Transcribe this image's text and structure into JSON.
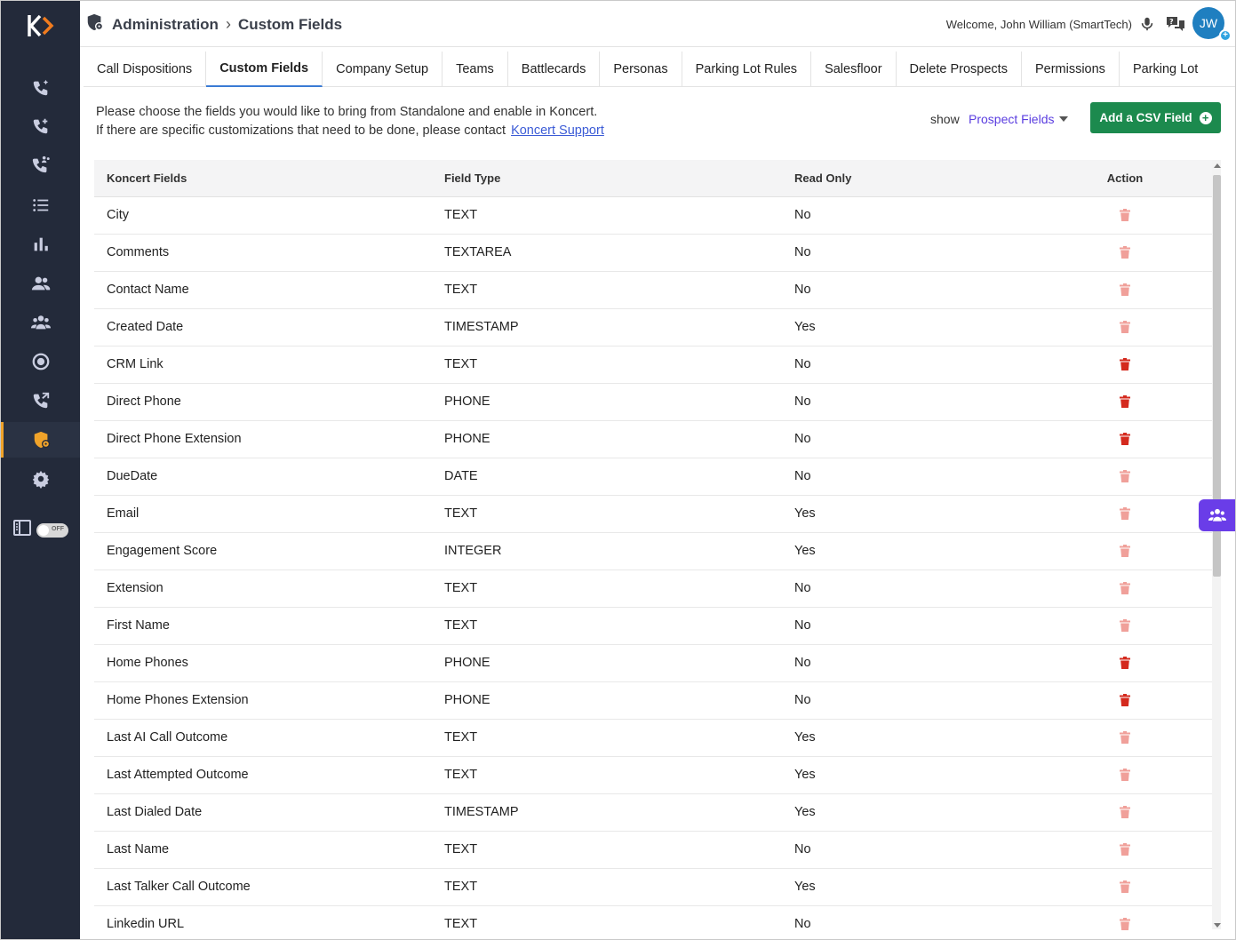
{
  "header": {
    "breadcrumb_root": "Administration",
    "breadcrumb_current": "Custom Fields",
    "welcome": "Welcome, John William (SmartTech)",
    "avatar_initials": "JW"
  },
  "sidebar": {
    "items": [
      "phone-sparkle-icon",
      "phone-plus-icon",
      "phone-group-icon",
      "list-icon",
      "bar-chart-icon",
      "users-icon",
      "team-icon",
      "target-icon",
      "phone-transfer-icon",
      "admin-shield-icon",
      "settings-icon"
    ],
    "active_item": "admin-shield-icon",
    "toggle_label": "OFF"
  },
  "tabs": [
    {
      "label": "Call Dispositions",
      "active": false
    },
    {
      "label": "Custom Fields",
      "active": true
    },
    {
      "label": "Company Setup",
      "active": false
    },
    {
      "label": "Teams",
      "active": false
    },
    {
      "label": "Battlecards",
      "active": false
    },
    {
      "label": "Personas",
      "active": false
    },
    {
      "label": "Parking Lot Rules",
      "active": false
    },
    {
      "label": "Salesfloor",
      "active": false
    },
    {
      "label": "Delete Prospects",
      "active": false
    },
    {
      "label": "Permissions",
      "active": false
    },
    {
      "label": "Parking Lot",
      "active": false
    }
  ],
  "intro": {
    "line1": "Please choose the fields you would like to bring from Standalone and enable in Koncert.",
    "line2": "If there are specific customizations that need to be done, please contact",
    "link": "Koncert Support"
  },
  "filter": {
    "label": "show",
    "selected": "Prospect Fields"
  },
  "add_button": "Add a CSV Field",
  "table": {
    "headers": [
      "Koncert Fields",
      "Field Type",
      "Read Only",
      "Action"
    ],
    "rows": [
      {
        "field": "City",
        "type": "TEXT",
        "read_only": "No",
        "deletable": false
      },
      {
        "field": "Comments",
        "type": "TEXTAREA",
        "read_only": "No",
        "deletable": false
      },
      {
        "field": "Contact Name",
        "type": "TEXT",
        "read_only": "No",
        "deletable": false
      },
      {
        "field": "Created Date",
        "type": "TIMESTAMP",
        "read_only": "Yes",
        "deletable": false
      },
      {
        "field": "CRM Link",
        "type": "TEXT",
        "read_only": "No",
        "deletable": true
      },
      {
        "field": "Direct Phone",
        "type": "PHONE",
        "read_only": "No",
        "deletable": true
      },
      {
        "field": "Direct Phone Extension",
        "type": "PHONE",
        "read_only": "No",
        "deletable": true
      },
      {
        "field": "DueDate",
        "type": "DATE",
        "read_only": "No",
        "deletable": false
      },
      {
        "field": "Email",
        "type": "TEXT",
        "read_only": "Yes",
        "deletable": false
      },
      {
        "field": "Engagement Score",
        "type": "INTEGER",
        "read_only": "Yes",
        "deletable": false
      },
      {
        "field": "Extension",
        "type": "TEXT",
        "read_only": "No",
        "deletable": false
      },
      {
        "field": "First Name",
        "type": "TEXT",
        "read_only": "No",
        "deletable": false
      },
      {
        "field": "Home Phones",
        "type": "PHONE",
        "read_only": "No",
        "deletable": true
      },
      {
        "field": "Home Phones Extension",
        "type": "PHONE",
        "read_only": "No",
        "deletable": true
      },
      {
        "field": "Last AI Call Outcome",
        "type": "TEXT",
        "read_only": "Yes",
        "deletable": false
      },
      {
        "field": "Last Attempted Outcome",
        "type": "TEXT",
        "read_only": "Yes",
        "deletable": false
      },
      {
        "field": "Last Dialed Date",
        "type": "TIMESTAMP",
        "read_only": "Yes",
        "deletable": false
      },
      {
        "field": "Last Name",
        "type": "TEXT",
        "read_only": "No",
        "deletable": false
      },
      {
        "field": "Last Talker Call Outcome",
        "type": "TEXT",
        "read_only": "Yes",
        "deletable": false
      },
      {
        "field": "Linkedin URL",
        "type": "TEXT",
        "read_only": "No",
        "deletable": false
      }
    ]
  },
  "colors": {
    "sidebar_bg": "#232a3a",
    "accent_orange": "#f0a32a",
    "trash_active": "#d42a1e",
    "trash_disabled": "#f0a09a",
    "add_button": "#1c8a4e",
    "link": "#5a3de0"
  }
}
